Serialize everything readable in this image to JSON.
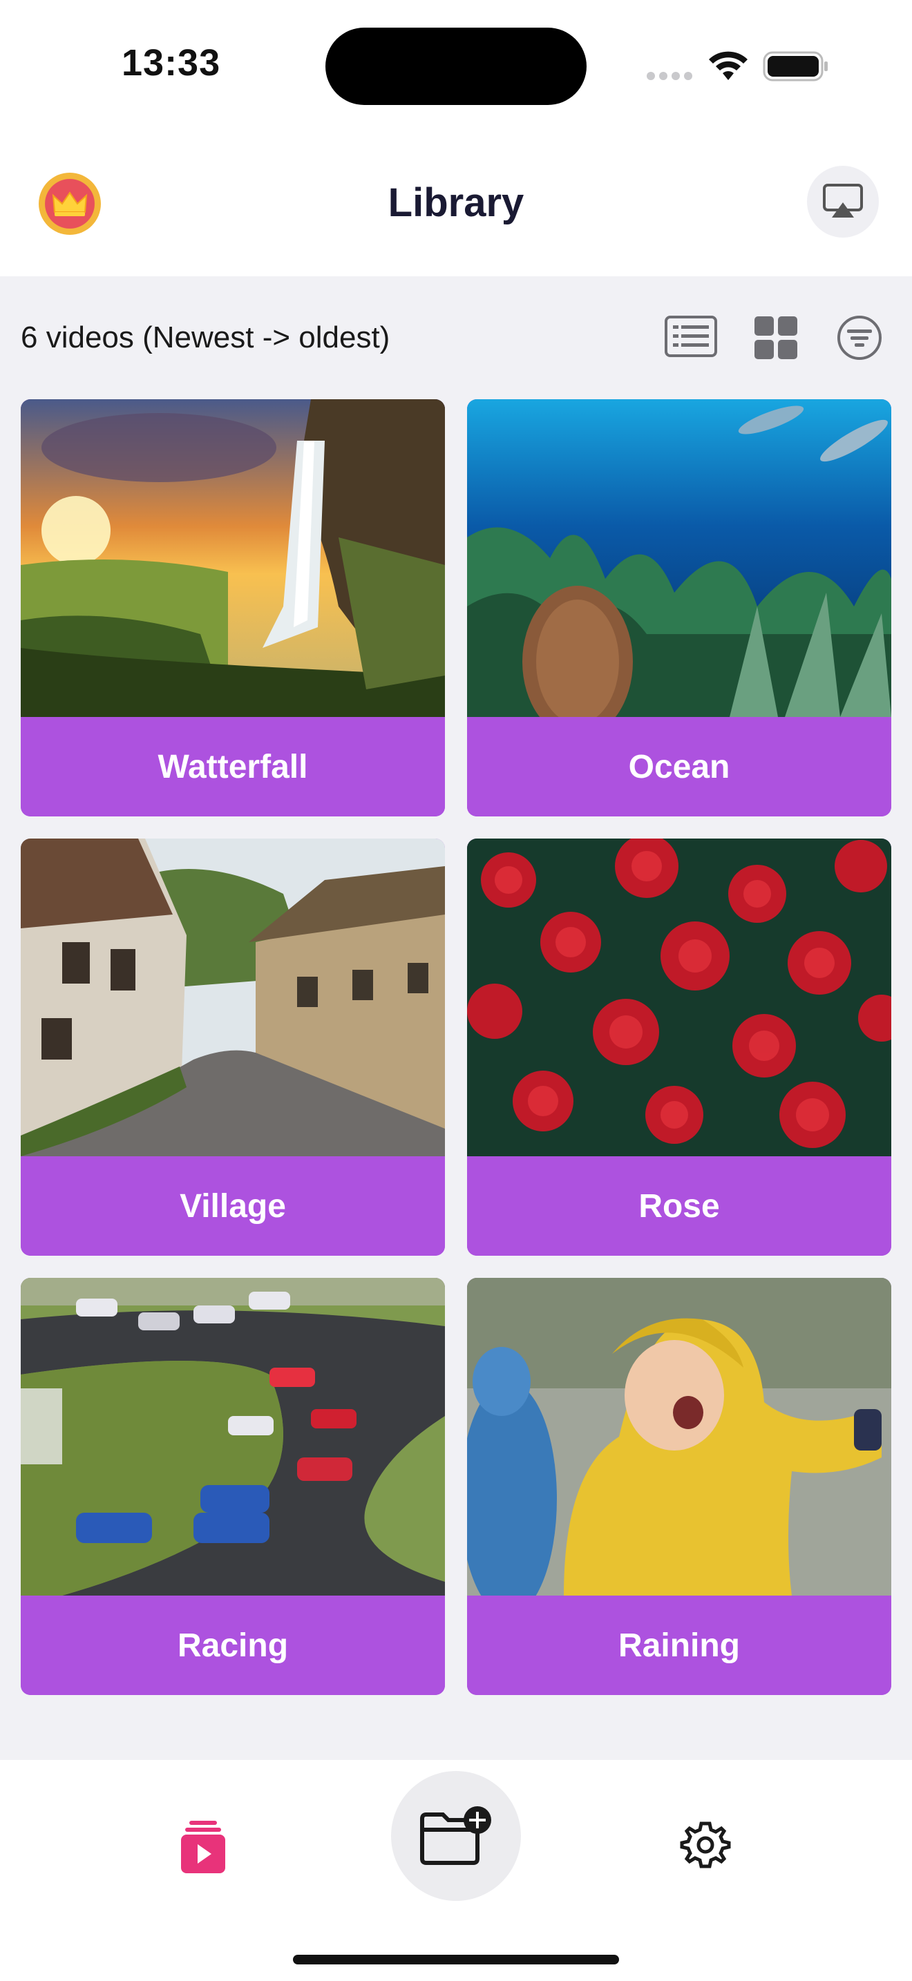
{
  "status_bar": {
    "time": "13:33"
  },
  "header": {
    "title": "Library"
  },
  "toolbar": {
    "count_label": "6 videos (Newest -> oldest)"
  },
  "icons": {
    "premium": "crown-icon",
    "airplay": "airplay-icon",
    "list_view": "list-view-icon",
    "grid_view": "grid-view-icon",
    "sort": "sort-icon",
    "tab_videos": "video-library-icon",
    "tab_add": "add-folder-icon",
    "tab_settings": "gear-icon"
  },
  "videos": [
    {
      "label": "Watterfall"
    },
    {
      "label": "Ocean"
    },
    {
      "label": "Village"
    },
    {
      "label": "Rose"
    },
    {
      "label": "Racing"
    },
    {
      "label": "Raining"
    }
  ],
  "colors": {
    "accent": "#ad52df",
    "tab_active": "#e8337a"
  }
}
